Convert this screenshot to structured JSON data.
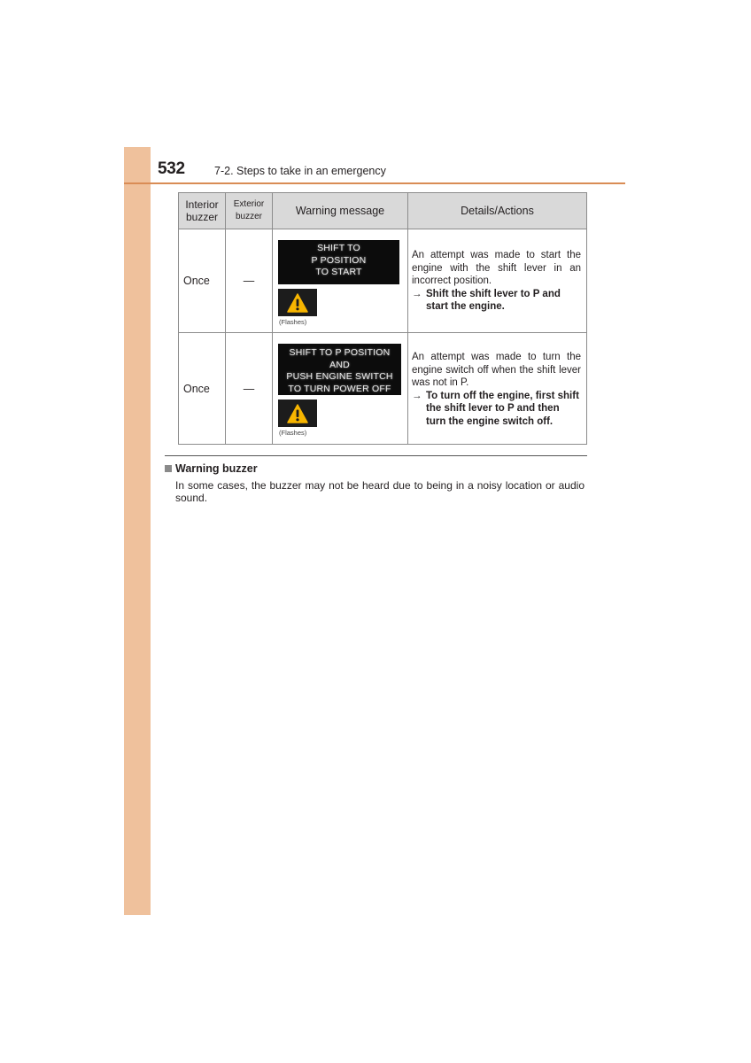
{
  "header": {
    "page_number": "532",
    "section_title": "7-2. Steps to take in an emergency"
  },
  "colors": {
    "side_tab": "#efc19c",
    "header_rule": "#d98c55",
    "warning_icon": "#f7b500"
  },
  "table": {
    "columns": {
      "interior_line1": "Interior",
      "interior_line2": "buzzer",
      "exterior_line1": "Exterior",
      "exterior_line2": "buzzer",
      "message": "Warning message",
      "details": "Details/Actions"
    },
    "rows": [
      {
        "interior_buzzer": "Once",
        "exterior_buzzer": "—",
        "message_lines": [
          "SHIFT TO",
          "P POSITION",
          "TO START"
        ],
        "icon": "warning-triangle-icon",
        "icon_caption": "(Flashes)",
        "detail": "An attempt was made to start the engine with the shift lever in an incorrect position.",
        "arrow": "→",
        "action": "Shift the shift lever to P and start the engine."
      },
      {
        "interior_buzzer": "Once",
        "exterior_buzzer": "—",
        "message_lines": [
          "SHIFT TO P POSITION",
          "AND",
          "PUSH ENGINE SWITCH",
          "TO TURN POWER OFF"
        ],
        "icon": "warning-triangle-icon",
        "icon_caption": "(Flashes)",
        "detail": "An attempt was made to turn the engine switch off when the shift lever was not in P.",
        "arrow": "→",
        "action": "To turn off the engine, first shift the shift lever to P and then turn the engine switch off."
      }
    ]
  },
  "note": {
    "title": "Warning buzzer",
    "body": "In some cases, the buzzer may not be heard due to being in a noisy location or audio sound."
  }
}
